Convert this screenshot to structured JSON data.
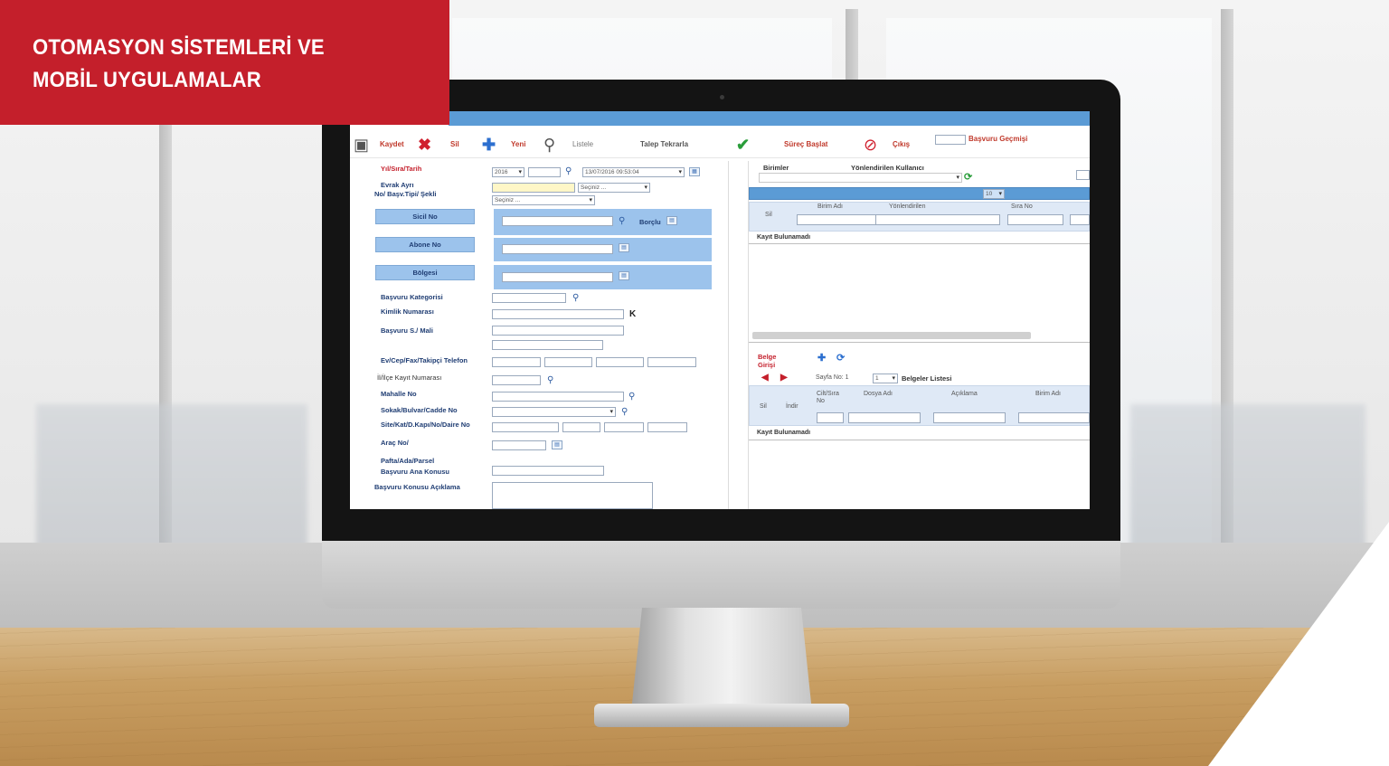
{
  "banner": {
    "line1": "OTOMASYON SİSTEMLERİ VE",
    "line2": "MOBİL UYGULAMALAR"
  },
  "toolbar": {
    "save": "Kaydet",
    "delete": "Sil",
    "new": "Yeni",
    "list": "Listele",
    "repeat": "Talep Tekrarla",
    "start_process": "Süreç Başlat",
    "exit": "Çıkış",
    "history": "Başvuru Geçmişi"
  },
  "form": {
    "year_number_date": "Yıl/Sıra/Tarih",
    "year_value": "2016",
    "date_value": "13/07/2016 09:53:04",
    "doc_type": "Evrak Ayrı",
    "app_type": "No/ Başv.Tipi/ Şekli",
    "select_default": "Seçiniz ...",
    "sicil_no": "Sicil No",
    "debt": "Borçlu",
    "subscriber_no": "Abone No",
    "region": "Bölgesi",
    "category": "Başvuru Kategorisi",
    "identity_no": "Kimlik Numarası",
    "applicant_name": "Başvuru S./ Mali",
    "phones": "Ev/Cep/Fax/Takipçi Telefon",
    "district_record": "İl/İlçe Kayıt Numarası",
    "neighborhood": "Mahalle No",
    "street": "Sokak/Bulvar/Cadde No",
    "site": "Site/Kat/D.Kapı/No/Daire No",
    "vehicle": "Araç No/",
    "parcel": "Pafta/Ada/Parsel",
    "main_topic": "Başvuru Ana Konusu",
    "topic_desc": "Başvuru Konusu Açıklama"
  },
  "right_panel": {
    "units": "Birimler",
    "assigned_users": "Yönlendirilen Kullanıcı",
    "col_delete": "Sil",
    "col_unit_name": "Birim Adı",
    "col_assignee": "Yönlendirilen",
    "col_order": "Sıra No",
    "empty_message": "Kayıt Bulunamadı",
    "page_size": "10",
    "doc_entry": "Belge Girişi",
    "page_no": "Sayfa No: 1",
    "page_select": "1",
    "doc_list": "Belgeler Listesi",
    "col_del2": "Sil",
    "col_view": "İndir",
    "col_cilt": "Cilt/Sıra No",
    "col_file": "Dosya Adı",
    "col_desc": "Açıklama",
    "col_unit2": "Birim Adı",
    "empty_message2": "Kayıt Bulunamadı"
  },
  "colors": {
    "brand_red": "#c41f2b",
    "ui_blue": "#5b9bd5",
    "button_blue": "#9cc3ec"
  }
}
